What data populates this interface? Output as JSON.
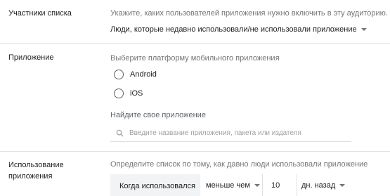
{
  "members": {
    "label": "Участники списка",
    "description": "Укажите, каких пользователей приложения нужно включить в эту аудиторию.",
    "selected": "Люди, которые недавно использовали/не использовали приложение"
  },
  "app": {
    "label": "Приложение",
    "platform_prompt": "Выберите платформу мобильного приложения",
    "platforms": [
      "Android",
      "iOS"
    ],
    "find_label": "Найдите свое приложение",
    "search_placeholder": "Введите название приложения, пакета или издателя"
  },
  "usage": {
    "label_line1": "Использование",
    "label_line2": "приложения",
    "description": "Определите список по тому, как давно люди использовали приложение",
    "when_label": "Когда использовался",
    "comparator": "меньше чем",
    "value": "10",
    "unit": "дн. назад"
  }
}
